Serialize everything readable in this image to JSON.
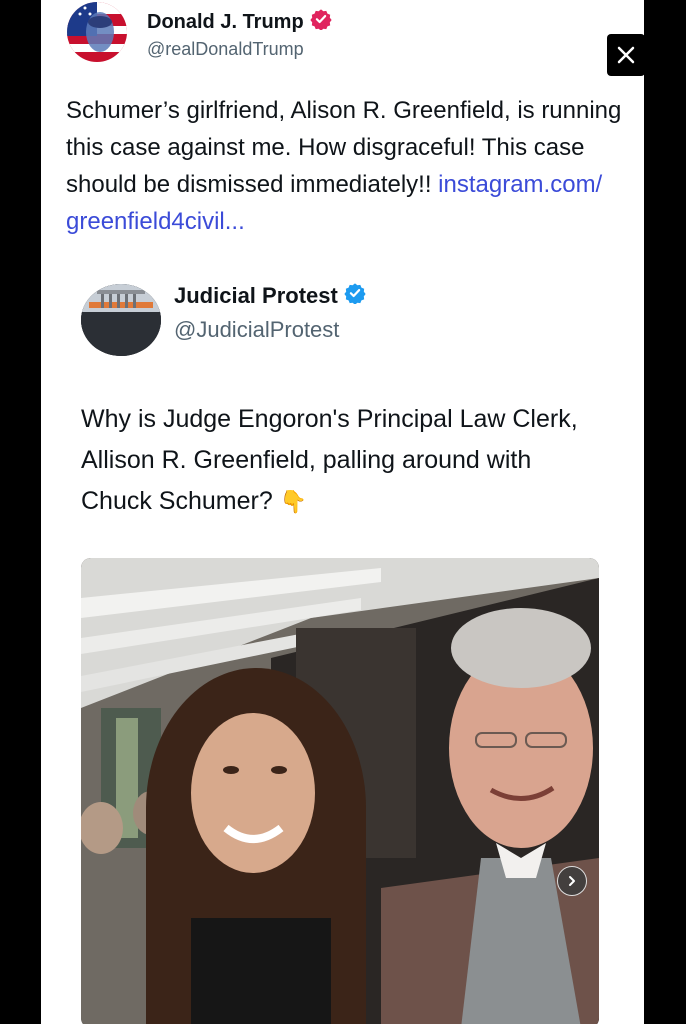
{
  "post": {
    "author_name": "Donald J. Trump",
    "author_handle": "@realDonaldTrump",
    "text": "Schumer’s girlfriend, Alison R. Greenfield, is running this case against me. How disgraceful! This case should be dismissed immediately!! ",
    "link_text": "instagram.com/ greenfield4civil..."
  },
  "quoted_post": {
    "author_name": "Judicial Protest",
    "author_handle": "@JudicialProtest",
    "text": "Why is Judge Engoron's Principal Law Clerk, Allison R. Greenfield, palling around with Chuck Schumer?",
    "emoji": "👇"
  },
  "icons": {
    "close": "close-icon",
    "verified": "verified-badge-icon",
    "carousel_next": "chevron-right-icon"
  },
  "colors": {
    "link": "#3b4bd8",
    "verified_main": "#e0245e",
    "verified_quote": "#1d9bf0"
  }
}
